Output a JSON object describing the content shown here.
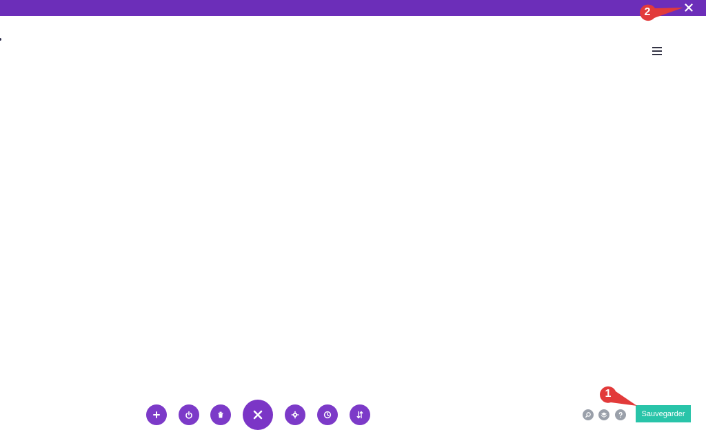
{
  "theme": {
    "top_bar_color": "#6c2eb9",
    "fab_color": "#7c3ac8",
    "save_color": "#29c4a9",
    "callout_color": "#e23a3a",
    "mini_icon_color": "#9aa0aa"
  },
  "top_bar": {
    "close_icon": "close-icon"
  },
  "header": {
    "menu_icon": "hamburger-icon"
  },
  "callouts": [
    {
      "number": "2"
    },
    {
      "number": "1"
    }
  ],
  "toolbar": {
    "buttons": [
      {
        "icon": "plus-icon"
      },
      {
        "icon": "power-icon"
      },
      {
        "icon": "trash-icon"
      },
      {
        "icon": "close-icon"
      },
      {
        "icon": "gear-icon"
      },
      {
        "icon": "history-icon"
      },
      {
        "icon": "sort-icon"
      }
    ]
  },
  "utilities": [
    {
      "icon": "search-icon"
    },
    {
      "icon": "layers-icon"
    },
    {
      "icon": "help-icon"
    }
  ],
  "save": {
    "label": "Sauvegarder"
  }
}
